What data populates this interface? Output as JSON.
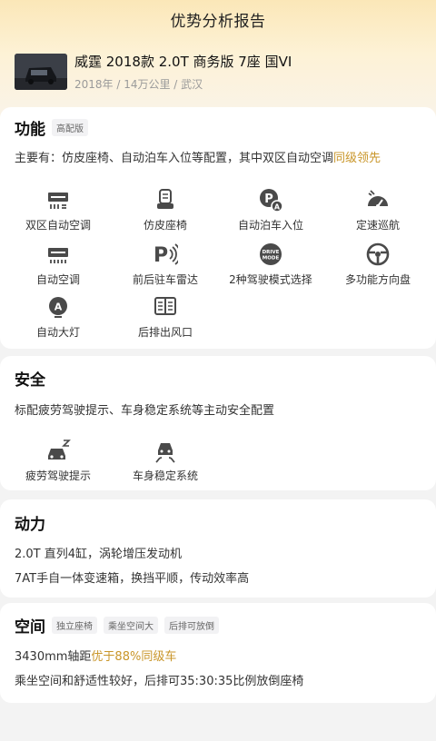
{
  "header": {
    "title": "优势分析报告"
  },
  "car": {
    "name": "威霆 2018款 2.0T 商务版 7座 国VI",
    "meta": "2018年 / 14万公里 / 武汉"
  },
  "function": {
    "title": "功能",
    "tag": "高配版",
    "desc_prefix": "主要有：仿皮座椅、自动泊车入位等配置，其中双区自动空调",
    "desc_highlight": "同级领先",
    "items": [
      {
        "label": "双区自动空调",
        "icon": "dual-zone-ac-icon"
      },
      {
        "label": "仿皮座椅",
        "icon": "leather-seat-icon"
      },
      {
        "label": "自动泊车入位",
        "icon": "auto-parking-icon"
      },
      {
        "label": "定速巡航",
        "icon": "cruise-control-icon"
      },
      {
        "label": "自动空调",
        "icon": "auto-ac-icon"
      },
      {
        "label": "前后驻车雷达",
        "icon": "parking-radar-icon"
      },
      {
        "label": "2种驾驶模式选择",
        "icon": "drive-mode-icon"
      },
      {
        "label": "多功能方向盘",
        "icon": "steering-wheel-icon"
      },
      {
        "label": "自动大灯",
        "icon": "auto-headlight-icon"
      },
      {
        "label": "后排出风口",
        "icon": "rear-vent-icon"
      }
    ],
    "drive_mode_text": "DRIVE MODE"
  },
  "safety": {
    "title": "安全",
    "desc": "标配疲劳驾驶提示、车身稳定系统等主动安全配置",
    "items": [
      {
        "label": "疲劳驾驶提示",
        "icon": "fatigue-alert-icon"
      },
      {
        "label": "车身稳定系统",
        "icon": "stability-control-icon"
      }
    ]
  },
  "power": {
    "title": "动力",
    "lines": [
      "2.0T 直列4缸，涡轮增压发动机",
      "7AT手自一体变速箱，换挡平顺，传动效率高"
    ]
  },
  "space": {
    "title": "空间",
    "tags": [
      "独立座椅",
      "乘坐空间大",
      "后排可放倒"
    ],
    "line1_prefix": "3430mm轴距",
    "line1_highlight": "优于88%同级车",
    "line2": "乘坐空间和舒适性较好，后排可35:30:35比例放倒座椅"
  },
  "colors": {
    "accent": "#c9962a",
    "icon": "#4a4a4a"
  }
}
